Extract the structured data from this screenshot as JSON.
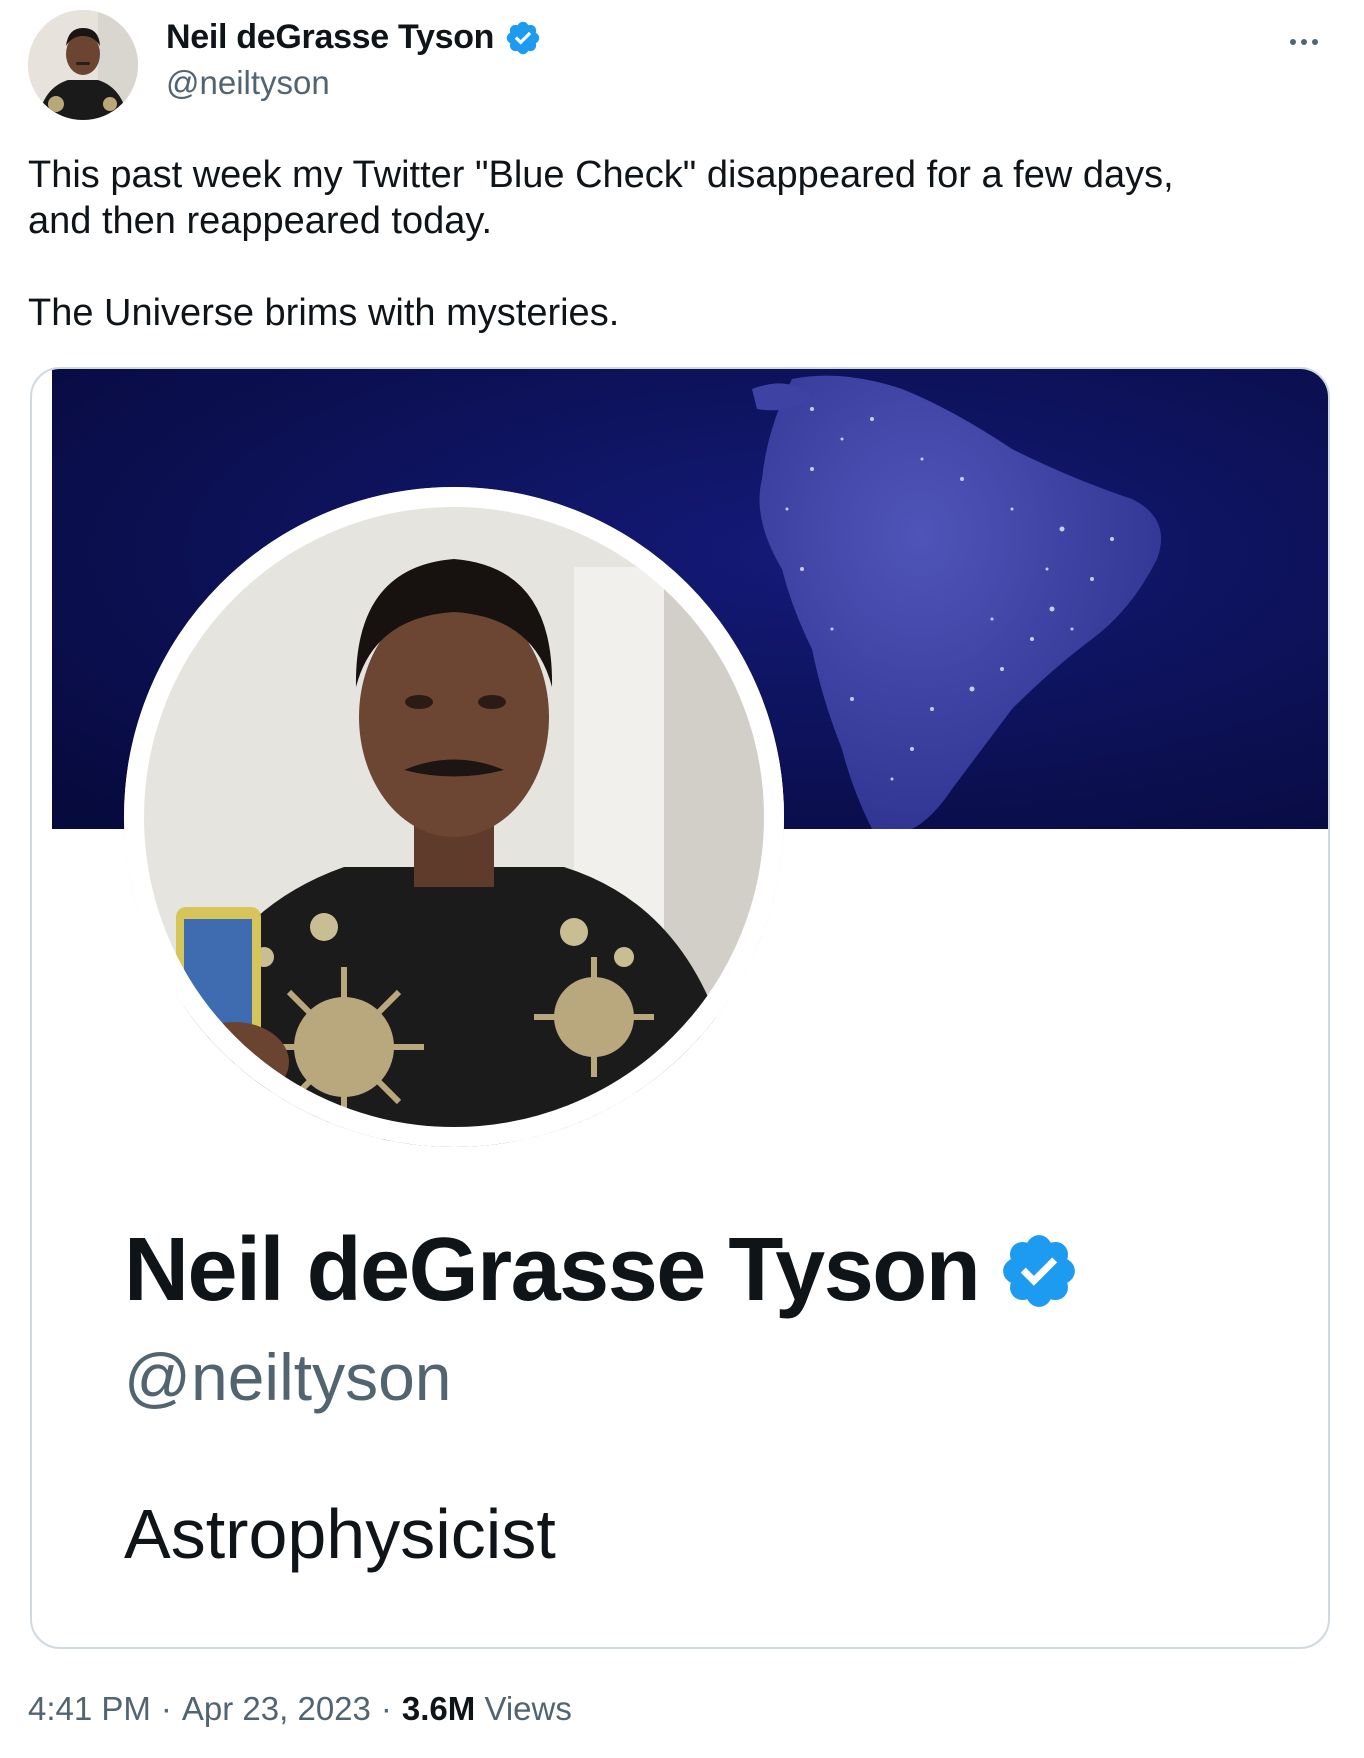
{
  "author": {
    "display_name": "Neil deGrasse Tyson",
    "handle": "@neiltyson",
    "verified_color": "#1d9bf0"
  },
  "tweet": {
    "text": "This past week my Twitter \"Blue Check\" disappeared for a few days,\nand then reappeared today.\n\nThe Universe brims with mysteries."
  },
  "media_card": {
    "display_name": "Neil deGrasse Tyson",
    "handle": "@neiltyson",
    "bio": "Astrophysicist",
    "banner_color": "#0b0d4f"
  },
  "meta": {
    "time": "4:41 PM",
    "separator": "·",
    "date": "Apr 23, 2023",
    "views_count": "3.6M",
    "views_label": "Views"
  },
  "icons": {
    "more": "more-icon",
    "verified": "verified-badge-icon"
  }
}
